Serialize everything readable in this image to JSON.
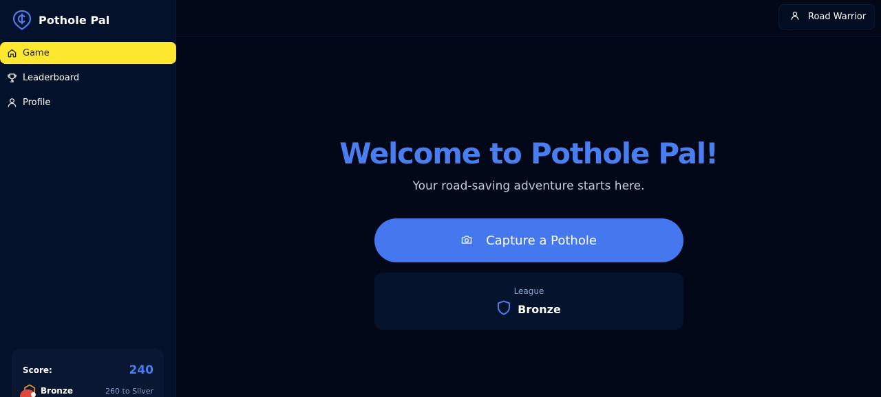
{
  "brand": {
    "name": "Pothole Pal",
    "icon": "pothole-pin-icon"
  },
  "sidebar": {
    "items": [
      {
        "label": "Game",
        "icon": "home-icon",
        "active": true
      },
      {
        "label": "Leaderboard",
        "icon": "trophy-icon",
        "active": false
      },
      {
        "label": "Profile",
        "icon": "user-icon",
        "active": false
      }
    ],
    "score_card": {
      "score_label": "Score:",
      "score_value": "240",
      "league_name": "Bronze",
      "next_league": "260 to Silver"
    }
  },
  "header": {
    "user_name": "Road Warrior",
    "user_icon": "user-icon"
  },
  "main": {
    "title": "Welcome to Pothole Pal!",
    "subtitle": "Your road-saving adventure starts here.",
    "capture_button": "Capture a Pothole",
    "capture_icon": "camera-icon",
    "league_caption": "League",
    "league_name": "Bronze",
    "league_icon": "shield-icon"
  },
  "colors": {
    "background": "#020817",
    "sidebar": "#04112b",
    "accent_blue": "#4577ee",
    "active_nav": "#fde72f",
    "card": "#06132d"
  }
}
